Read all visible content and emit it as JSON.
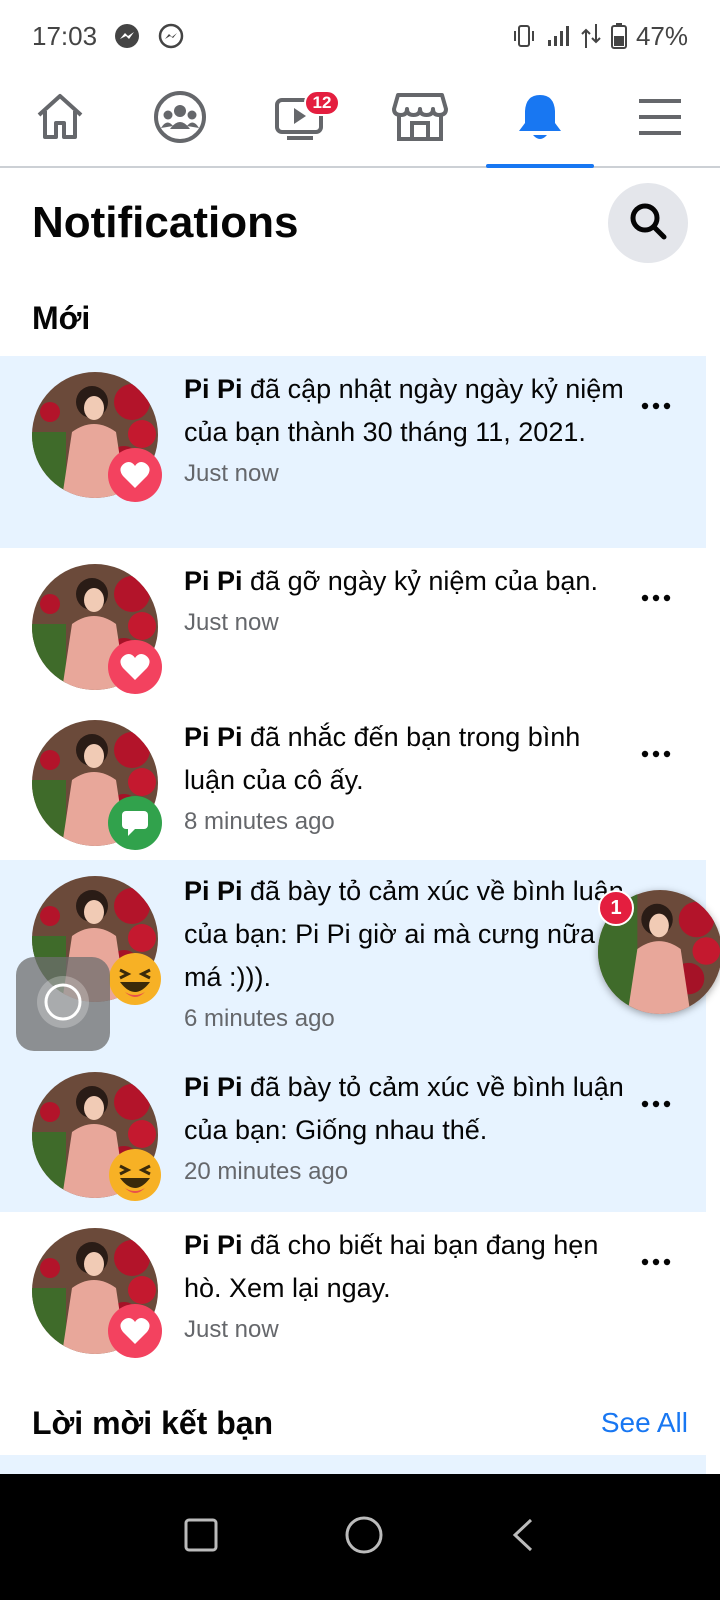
{
  "status_bar": {
    "time": "17:03",
    "battery": "47%",
    "left_icons": [
      "messenger-icon",
      "messenger-outline-icon"
    ],
    "right_icons": [
      "vibrate-icon",
      "signal-icon",
      "data-arrows-icon",
      "battery-icon"
    ]
  },
  "nav": {
    "items": [
      {
        "icon": "home-icon"
      },
      {
        "icon": "groups-icon"
      },
      {
        "icon": "watch-icon",
        "badge": "12"
      },
      {
        "icon": "marketplace-icon"
      },
      {
        "icon": "bell-icon",
        "active": true
      },
      {
        "icon": "menu-icon"
      }
    ],
    "accent": "#1877f2"
  },
  "page": {
    "title": "Notifications",
    "search_icon": "search-icon"
  },
  "sections": {
    "new_label": "Mới"
  },
  "notifications": [
    {
      "name": "Pi Pi",
      "text": " đã cập nhật ngày ngày kỷ niệm của bạn thành 30 tháng 11, 2021.",
      "time": "Just now",
      "type": "love",
      "unread": true
    },
    {
      "name": "Pi Pi",
      "text": " đã gỡ ngày kỷ niệm của bạn.",
      "time": "Just now",
      "type": "love",
      "unread": false
    },
    {
      "name": "Pi Pi",
      "text": " đã nhắc đến bạn trong bình luận của cô ấy.",
      "time": "8 minutes ago",
      "type": "comment",
      "unread": false
    },
    {
      "name": "Pi Pi",
      "text": " đã bày tỏ cảm xúc về bình luận của bạn: Pi Pi giờ ai mà cưng nữa má :))).",
      "time": "6 minutes ago",
      "type": "haha",
      "unread": true
    },
    {
      "name": "Pi Pi",
      "text": " đã bày tỏ cảm xúc về bình luận của bạn: Giống nhau thế.",
      "time": "20 minutes ago",
      "type": "haha",
      "unread": true
    },
    {
      "name": "Pi Pi",
      "text": " đã cho biết hai bạn đang hẹn hò. Xem lại ngay.",
      "time": "Just now",
      "type": "love",
      "unread": false
    }
  ],
  "friend_requests": {
    "title": "Lời mời kết bạn",
    "see_all": "See All"
  },
  "chat_head": {
    "badge": "1"
  }
}
